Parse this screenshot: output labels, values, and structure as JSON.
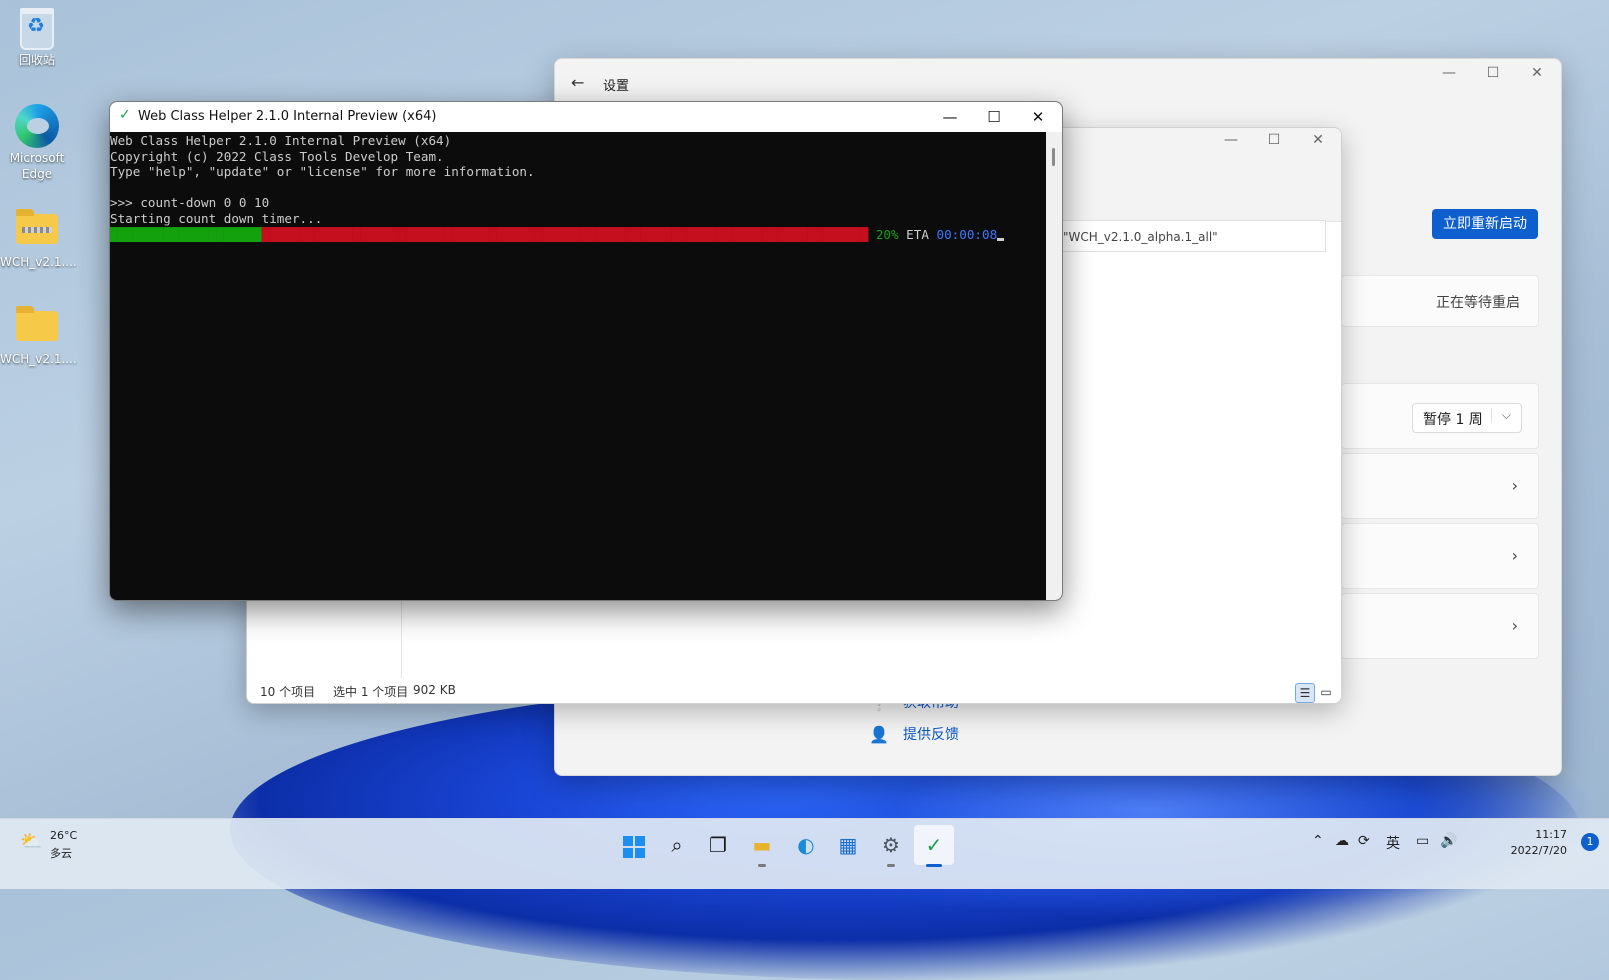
{
  "desktop": {
    "icons": [
      {
        "label": "回收站"
      },
      {
        "label": "Microsoft Edge"
      },
      {
        "label": "WCH_v2.1...."
      },
      {
        "label": "WCH_v2.1...."
      }
    ]
  },
  "settings": {
    "title": "设置",
    "restart_button": "立即重新启动",
    "pending_status": "正在等待重启",
    "pause_option": "暂停 1 周",
    "help_link": "获取帮助",
    "feedback_link": "提供反馈"
  },
  "explorer": {
    "address": "\"WCH_v2.1.0_alpha.1_all\"",
    "status_items": "10 个项目",
    "status_selected": "选中 1 个项目",
    "status_size": "902 KB"
  },
  "console": {
    "title": "Web Class Helper 2.1.0 Internal Preview (x64)",
    "lines": [
      "Web Class Helper 2.1.0 Internal Preview (x64)",
      "Copyright (c) 2022 Class Tools Develop Team.",
      "Type \"help\", \"update\" or \"license\" for more information.",
      "",
      ">>> count-down 0 0 10",
      "Starting count down timer..."
    ],
    "progress_done": "████████████████████",
    "progress_left": "████████████████████████████████████████████████████████████████████████████████",
    "progress_percent": " 20%",
    "eta_label": " ETA ",
    "eta_value": "00:00:08"
  },
  "taskbar": {
    "weather_temp": "26°C",
    "weather_cond": "多云",
    "ime": "英",
    "time": "11:17",
    "date": "2022/7/20",
    "notifications": "1",
    "apps": [
      "start-icon",
      "search-icon",
      "task-view-icon",
      "file-explorer-icon",
      "edge-icon",
      "store-icon",
      "settings-icon",
      "wch-icon"
    ]
  },
  "colors": {
    "accent": "#0c5fcd",
    "progress_done": "#13a10e",
    "progress_left": "#c50f1f",
    "eta": "#3b78ff"
  }
}
